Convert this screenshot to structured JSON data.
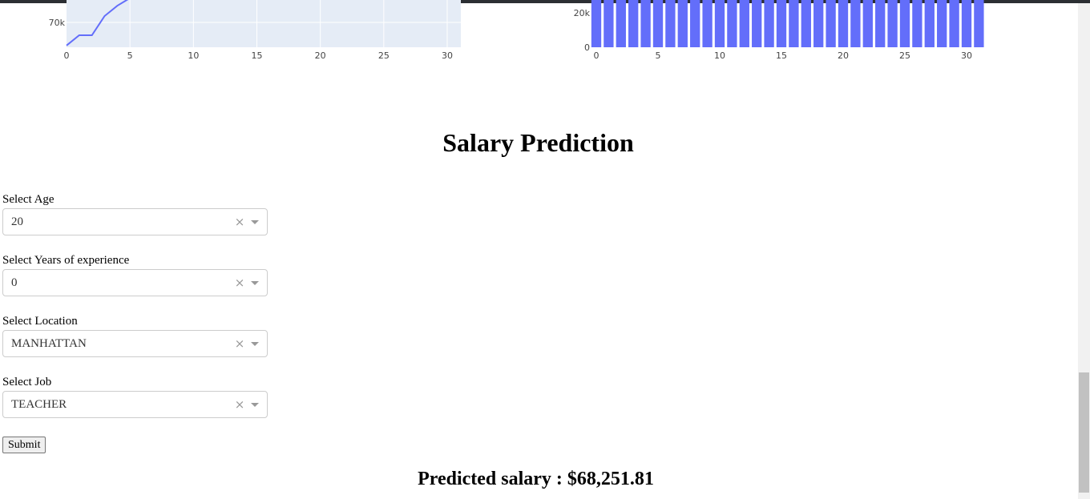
{
  "page": {
    "title": "Salary Prediction",
    "result_prefix": "Predicted salary : ",
    "result_value": "$68,251.81"
  },
  "form": {
    "fields": [
      {
        "label": "Select Age",
        "value": "20"
      },
      {
        "label": "Select Years of experience",
        "value": "0"
      },
      {
        "label": "Select Location",
        "value": "MANHATTAN"
      },
      {
        "label": "Select Job",
        "value": "TEACHER"
      }
    ],
    "clear_glyph": "×",
    "submit_label": "Submit"
  },
  "colors": {
    "plot_bg": "#e5ecf6",
    "series": "#636efa",
    "topbar": "#2c2f33"
  },
  "chart_data": [
    {
      "type": "line",
      "x": [
        0,
        1,
        2,
        3,
        4,
        5
      ],
      "y": [
        68200,
        69000,
        69000,
        70500,
        71300,
        71900
      ],
      "xlim": [
        -0.5,
        31
      ],
      "x_ticks": [
        0,
        5,
        10,
        15,
        20,
        25,
        30
      ],
      "y_ticks_visible": [
        "70k"
      ],
      "y_tick_values": [
        70000
      ],
      "grid": true,
      "xlabel": "",
      "ylabel": "",
      "note": "upper portion scrolled out of view"
    },
    {
      "type": "bar",
      "x": [
        0,
        1,
        2,
        3,
        4,
        5,
        6,
        7,
        8,
        9,
        10,
        11,
        12,
        13,
        14,
        15,
        16,
        17,
        18,
        19,
        20,
        21,
        22,
        23,
        24,
        25,
        26,
        27,
        28,
        29,
        30,
        31
      ],
      "values": [
        68250,
        68250,
        68250,
        68250,
        68250,
        68250,
        68250,
        68250,
        68250,
        68250,
        68250,
        68250,
        68250,
        68250,
        68250,
        68250,
        68250,
        68250,
        68250,
        68250,
        68250,
        68250,
        68250,
        68250,
        68250,
        68250,
        68250,
        68250,
        68250,
        68250,
        68250,
        68250
      ],
      "xlim": [
        -0.5,
        31.5
      ],
      "x_ticks": [
        0,
        5,
        10,
        15,
        20,
        25,
        30
      ],
      "y_ticks_visible": [
        "0",
        "20k"
      ],
      "y_tick_values": [
        0,
        20000
      ],
      "xlabel": "",
      "ylabel": ""
    }
  ]
}
